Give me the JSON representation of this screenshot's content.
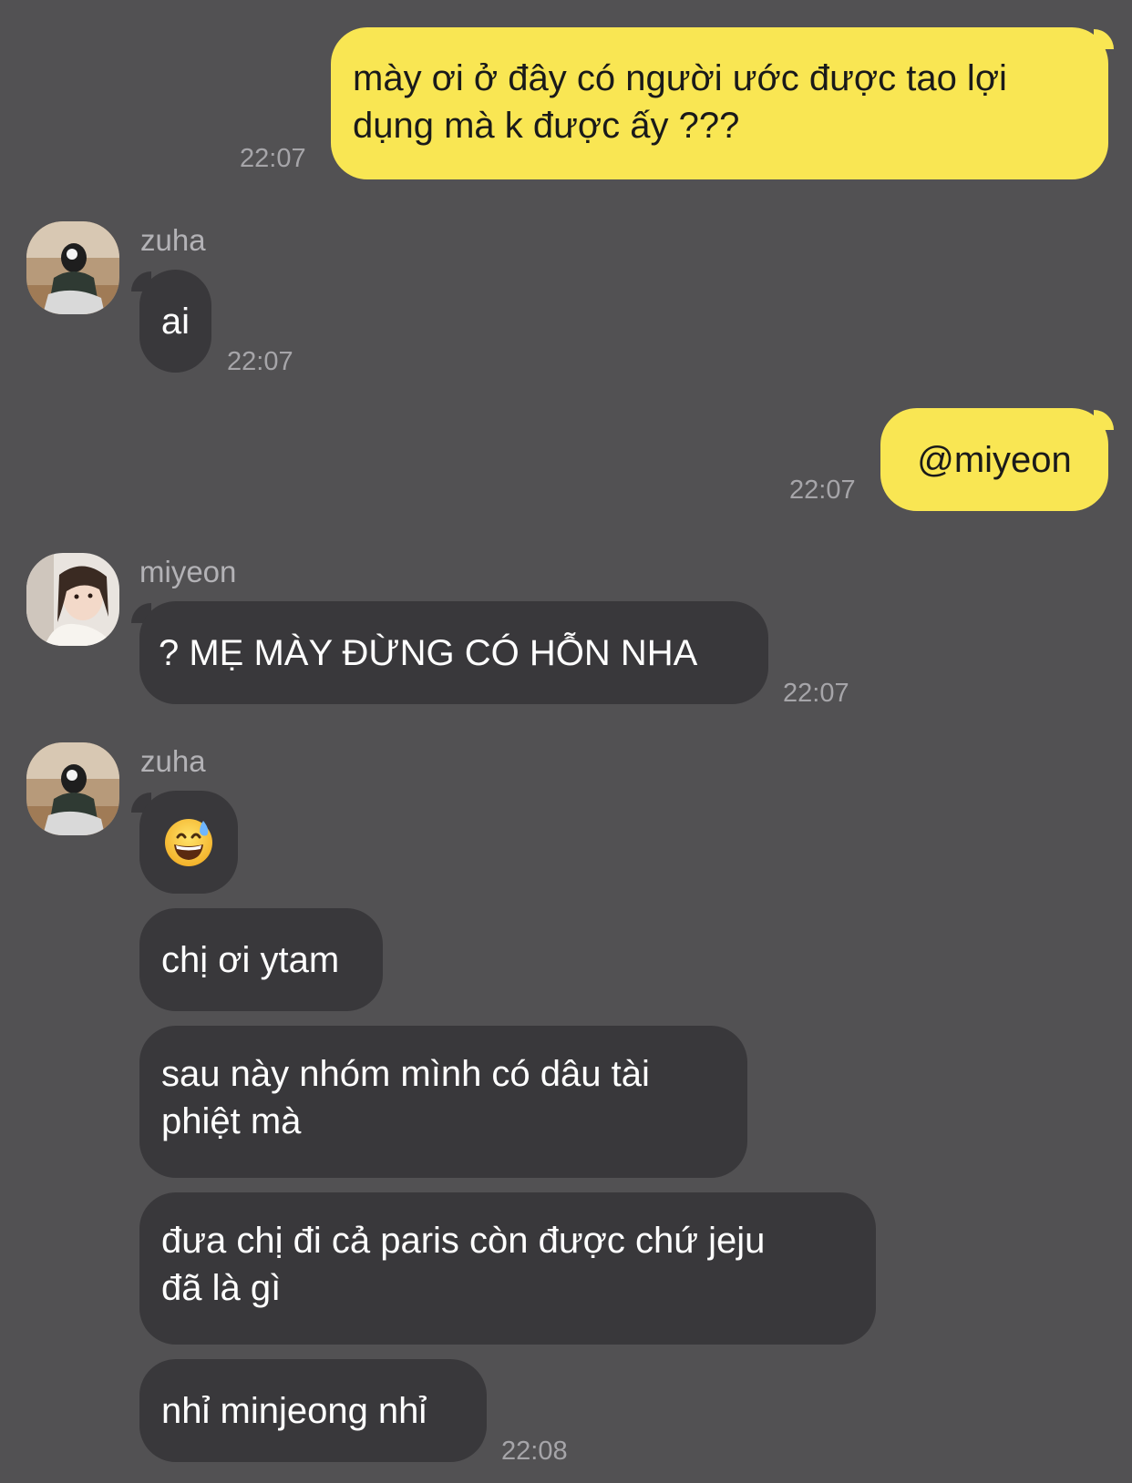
{
  "colors": {
    "background": "#525153",
    "incoming_bubble": "#39383b",
    "outgoing_bubble": "#f9e653",
    "timestamp": "#a6a5a9"
  },
  "messages": [
    {
      "id": "m1",
      "direction": "outgoing",
      "text": "mày ơi ở đây có người ước được tao lợi dụng mà k được ấy ???",
      "line1": "mày ơi ở đây có người ước được tao lợi",
      "line2": "dụng mà k được ấy ???",
      "time": "22:07"
    },
    {
      "id": "m2",
      "direction": "incoming",
      "sender": "zuha",
      "avatar": "zuha-avatar",
      "text": "ai",
      "time": "22:07"
    },
    {
      "id": "m3",
      "direction": "outgoing",
      "text": "@miyeon",
      "time": "22:07"
    },
    {
      "id": "m4",
      "direction": "incoming",
      "sender": "miyeon",
      "avatar": "miyeon-avatar",
      "text": "? MẸ MÀY ĐỪNG CÓ HỖN NHA",
      "time": "22:07"
    },
    {
      "id": "m5",
      "direction": "incoming",
      "sender": "zuha",
      "avatar": "zuha-avatar",
      "emoji": "grinning-face-with-sweat-emoji",
      "group": [
        {
          "text": "chị ơi ytam"
        },
        {
          "text": "sau này nhóm mình có dâu tài phiệt mà",
          "line1": "sau này nhóm mình có dâu tài",
          "line2": "phiệt mà"
        },
        {
          "text": "đưa chị đi cả paris còn được chứ jeju đã là gì",
          "line1": "đưa chị đi cả paris còn được chứ jeju",
          "line2": "đã là gì"
        },
        {
          "text": "nhỉ minjeong nhỉ"
        }
      ],
      "time": "22:08"
    }
  ]
}
